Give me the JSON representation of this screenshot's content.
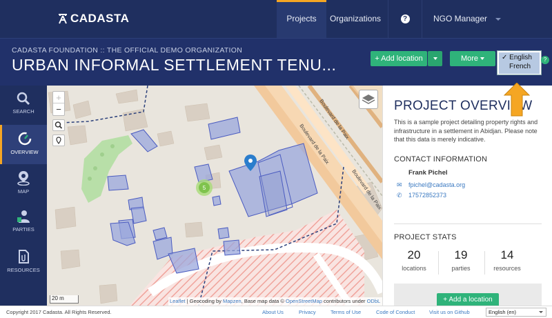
{
  "nav": {
    "brand": "CADASTA",
    "projects": "Projects",
    "organizations": "Organizations",
    "help": "?",
    "user": "NGO Manager"
  },
  "header": {
    "org_name": "CADASTA FOUNDATION :: THE OFFICIAL DEMO ORGANIZATION",
    "title": "URBAN INFORMAL SETTLEMENT TENU...",
    "add_location": "+ Add location",
    "more": "More",
    "languages": [
      "✓ English",
      "French"
    ],
    "help": "?"
  },
  "sidebar": {
    "items": [
      {
        "label": "SEARCH",
        "icon": "search-icon"
      },
      {
        "label": "OVERVIEW",
        "icon": "overview-icon"
      },
      {
        "label": "MAP",
        "icon": "map-pin-icon"
      },
      {
        "label": "PARTIES",
        "icon": "parties-icon"
      },
      {
        "label": "RESOURCES",
        "icon": "resources-icon"
      }
    ]
  },
  "map": {
    "zoom_in": "+",
    "zoom_out": "−",
    "cluster_count": "5",
    "scale": "20 m",
    "street_1": "Boulevard de la Paix",
    "street_2": "Boulevard de la Paix",
    "street_3": "Boulevard de la Paix",
    "attribution_leaflet": "Leaflet",
    "attribution_text_1": " | Geocoding by ",
    "attribution_mapzen": "Mapzen",
    "attribution_text_2": ", Base map data © ",
    "attribution_osm": "OpenStreetMap",
    "attribution_text_3": " contributors under ",
    "attribution_odbl": "ODbL"
  },
  "panel": {
    "title": "PROJECT OVERVIEW",
    "description": "This is a sample project detailing property rights and infrastructure in a settlement in Abidjan. Please note that this data is merely indicative.",
    "contact_heading": "CONTACT INFORMATION",
    "contact_name": "Frank Pichel",
    "contact_email": "fpichel@cadasta.org",
    "contact_phone": "17572852373",
    "stats_heading": "PROJECT STATS",
    "stats": [
      {
        "value": "20",
        "label": "locations"
      },
      {
        "value": "19",
        "label": "parties"
      },
      {
        "value": "14",
        "label": "resources"
      }
    ],
    "add_location": "+ Add a location"
  },
  "footer": {
    "copyright": "Copyright 2017 Cadasta. All Rights Reserved.",
    "links": [
      "About Us",
      "Privacy",
      "Terms of Use",
      "Code of Conduct",
      "Visit us on Github"
    ],
    "language": "English (en)"
  },
  "colors": {
    "navy": "#1f2f5f",
    "accent": "#f5a623",
    "green": "#2fb37a",
    "link": "#3a79c1"
  }
}
